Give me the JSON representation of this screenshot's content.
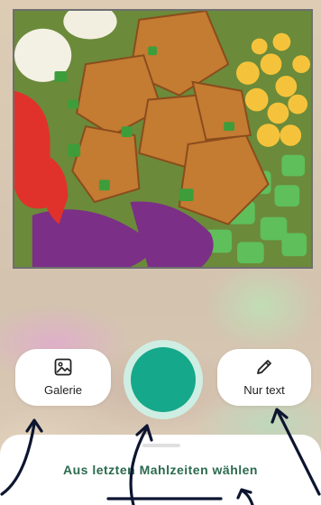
{
  "camera": {
    "gallery_label": "Galerie",
    "text_only_label": "Nur text",
    "shutter_color": "#16a88a"
  },
  "sheet": {
    "title": "Aus letzten Mahlzeiten wählen"
  },
  "icons": {
    "gallery": "image-icon",
    "text_only": "pencil-icon"
  },
  "colors": {
    "accent": "#16a88a",
    "accent_ring": "#cfeee3",
    "sheet_title": "#2b6a4f"
  }
}
